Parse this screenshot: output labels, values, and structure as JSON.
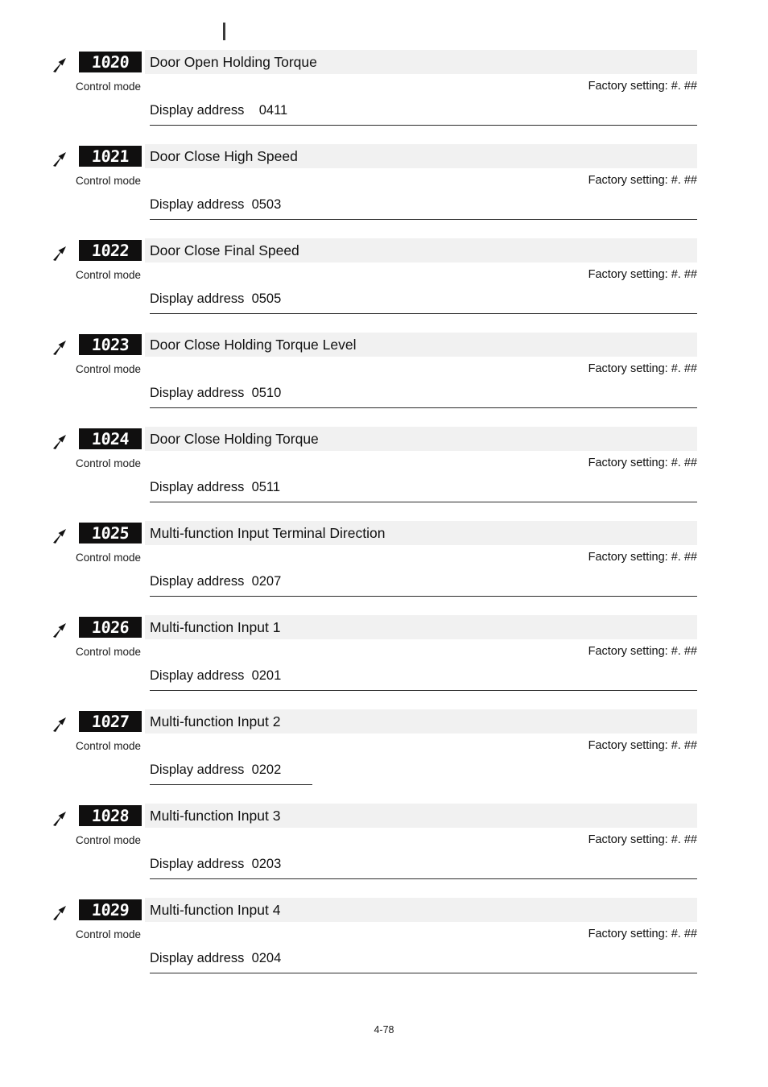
{
  "page": {
    "footer_label": "4-78",
    "top_mark": "|",
    "band_color": "#f1f1f1",
    "badge_bg_color": "#100f0f",
    "badge_digit_color": "#ffffff",
    "rule_color": "#2b2b2b"
  },
  "labels": {
    "control_mode": "Control mode",
    "factory_setting": "Factory setting: #. ##",
    "display_address": "Display address",
    "marker_icon": "lightning-bolt-icon"
  },
  "parameters": [
    {
      "code": "10.20",
      "title": "Door Open Holding Torque",
      "control_mode": "Control mode",
      "factory_setting": "Factory setting: #. ##",
      "address_label": "Display address",
      "address": "0411",
      "address_gap": "wide",
      "rule_width": 680
    },
    {
      "code": "10.21",
      "title": "Door Close High Speed",
      "control_mode": "Control mode",
      "factory_setting": "Factory setting: #. ##",
      "address_label": "Display address",
      "address": "0503",
      "address_gap": "narrow",
      "rule_width": 680
    },
    {
      "code": "10.22",
      "title": "Door Close Final Speed",
      "control_mode": "Control mode",
      "factory_setting": "Factory setting: #. ##",
      "address_label": "Display address",
      "address": "0505",
      "address_gap": "narrow",
      "rule_width": 680
    },
    {
      "code": "10.23",
      "title": "Door Close Holding Torque Level",
      "control_mode": "Control mode",
      "factory_setting": "Factory setting: #. ##",
      "address_label": "Display address",
      "address": "0510",
      "address_gap": "narrow",
      "rule_width": 680
    },
    {
      "code": "10.24",
      "title": "Door Close Holding Torque",
      "control_mode": "Control mode",
      "factory_setting": "Factory setting: #. ##",
      "address_label": "Display address",
      "address": "0511",
      "address_gap": "narrow",
      "rule_width": 680
    },
    {
      "code": "10.25",
      "title": "Multi-function Input Terminal Direction",
      "control_mode": "Control mode",
      "factory_setting": "Factory setting: #. ##",
      "address_label": "Display address",
      "address": "0207",
      "address_gap": "narrow",
      "rule_width": 680
    },
    {
      "code": "10.26",
      "title": "Multi-function Input 1",
      "control_mode": "Control mode",
      "factory_setting": "Factory setting: #. ##",
      "address_label": "Display address",
      "address": "0201",
      "address_gap": "narrow",
      "rule_width": 680
    },
    {
      "code": "10.27",
      "title": "Multi-function Input 2",
      "control_mode": "Control mode",
      "factory_setting": "Factory setting: #. ##",
      "address_label": "Display address",
      "address": "0202",
      "address_gap": "narrow",
      "rule_width": 202
    },
    {
      "code": "10.28",
      "title": "Multi-function Input 3",
      "control_mode": "Control mode",
      "factory_setting": "Factory setting: #. ##",
      "address_label": "Display address",
      "address": "0203",
      "address_gap": "narrow",
      "rule_width": 680
    },
    {
      "code": "10.29",
      "title": "Multi-function Input 4",
      "control_mode": "Control mode",
      "factory_setting": "Factory setting: #. ##",
      "address_label": "Display address",
      "address": "0204",
      "address_gap": "narrow",
      "rule_width": 680
    }
  ]
}
